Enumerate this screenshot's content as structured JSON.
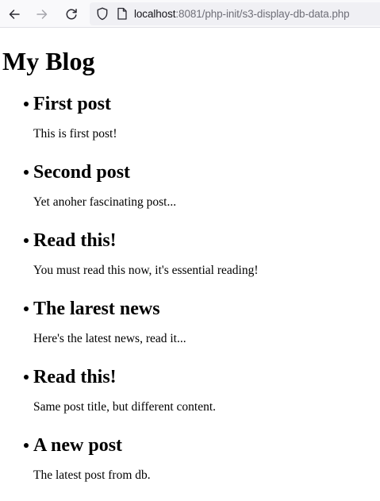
{
  "browser": {
    "url_host": "localhost",
    "url_rest": ":8081/php-init/s3-display-db-data.php"
  },
  "page": {
    "title": "My Blog",
    "posts": [
      {
        "title": "First post",
        "body": "This is first post!"
      },
      {
        "title": "Second post",
        "body": "Yet anoher fascinating post..."
      },
      {
        "title": "Read this!",
        "body": "You must read this now, it's essential reading!"
      },
      {
        "title": "The larest news",
        "body": "Here's the latest news, read it..."
      },
      {
        "title": "Read this!",
        "body": "Same post title, but different content."
      },
      {
        "title": "A new post",
        "body": "The latest post from db."
      }
    ]
  }
}
